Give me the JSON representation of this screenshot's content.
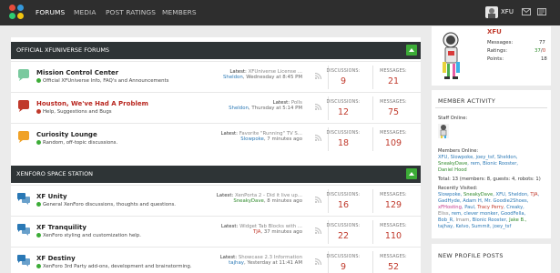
{
  "nav": {
    "items": [
      "FORUMS",
      "MEDIA",
      "POST RATINGS",
      "MEMBERS"
    ],
    "user": "XFU"
  },
  "categories": [
    {
      "title": "OFFICIAL XFUNIVERSE FORUMS",
      "forums": [
        {
          "title": "Mission Control Center",
          "desc": "Official XFUniverse Info, FAQ's and Announcements",
          "latest_thread": "XFUniverse License ...",
          "latest_user": "Sheldon",
          "latest_time": "Wednesday at 8:45 PM",
          "discussions": "9",
          "messages": "21",
          "icon_color": "#79c99e",
          "red": false
        },
        {
          "title": "Houston, We've Had A Problem",
          "desc": "Help, Suggestions and Bugs",
          "latest_thread": "Polls",
          "latest_user": "Sheldon",
          "latest_time": "Thursday at 5:14 PM",
          "discussions": "12",
          "messages": "75",
          "icon_color": "#c0392b",
          "red": true
        },
        {
          "title": "Curiosity Lounge",
          "desc": "Random, off-topic discussions.",
          "latest_thread": "Favorite \"Running\" TV S...",
          "latest_user": "Slowpoke",
          "latest_time": "7 minutes ago",
          "discussions": "18",
          "messages": "109",
          "icon_color": "#f0a228",
          "red": false
        }
      ]
    },
    {
      "title": "XENFORO SPACE STATION",
      "forums": [
        {
          "title": "XF Unity",
          "desc": "General XenForo discussions, thoughts and questions.",
          "latest_thread": "XenPorta 2 - Did it live up...",
          "latest_user": "SneakyDave",
          "latest_time": "8 minutes ago",
          "discussions": "16",
          "messages": "129",
          "icon_color": "#2a78b5",
          "red": false,
          "latest_user_green": true
        },
        {
          "title": "XF Tranquility",
          "desc": "XenForo styling and customization help.",
          "latest_thread": "Widget Tab Blocks with ...",
          "latest_user": "TJA",
          "latest_time": "37 minutes ago",
          "discussions": "22",
          "messages": "110",
          "icon_color": "#2a78b5",
          "red": false,
          "latest_user_red": true
        },
        {
          "title": "XF Destiny",
          "desc": "XenForo 3rd Party add-ons, development and brainstorming.",
          "latest_thread": "Showcase 2.3 Information",
          "latest_user": "tajhay",
          "latest_time": "Yesterday at 11:41 AM",
          "discussions": "9",
          "messages": "52",
          "icon_color": "#2a78b5",
          "red": false
        }
      ]
    }
  ],
  "labels": {
    "latest": "Latest:",
    "discussions": "DISCUSSIONS:",
    "messages": "MESSAGES:"
  },
  "sidebar": {
    "user": {
      "name": "XFU",
      "messages_label": "Messages:",
      "messages": "77",
      "ratings_label": "Ratings:",
      "ratings_pos": "37",
      "ratings_neg": "0",
      "points_label": "Points:",
      "points": "18"
    },
    "member_activity": {
      "title": "MEMBER ACTIVITY",
      "staff_label": "Staff Online:",
      "members_label": "Members Online:",
      "members_line1": "XFU, Slowpoke, joey_tsf, Sheldon,",
      "members_line2a": "SneakyDave",
      "members_line2b": ", rem, Bionic Rooster,",
      "members_line3": "Daniel Hood",
      "total": "Total: 13 (members: 8, guests: 4, robots: 1)",
      "recent_label": "Recently Visited:",
      "recent_line1": [
        "Slowpoke, ",
        "SneakyDave",
        ", XFU, Sheldon, ",
        "TJA",
        ","
      ],
      "recent_line2": "GadHyde, Adam H, Mr. Goodie2Shoes,",
      "recent_line3": [
        "xFHosting",
        ", Paul, ",
        "Tracy Perry",
        ", Creaky,"
      ],
      "recent_line4": [
        "Eliss",
        ", rem, clever monker, GoodFella,"
      ],
      "recent_line5": [
        "Bob_R, ",
        "Imam",
        ", Bionic Rooster, ",
        "Jake B.,"
      ],
      "recent_line6": "tajhay, Kelvo, Summit, joey_tsf"
    },
    "new_posts_title": "NEW PROFILE POSTS"
  }
}
